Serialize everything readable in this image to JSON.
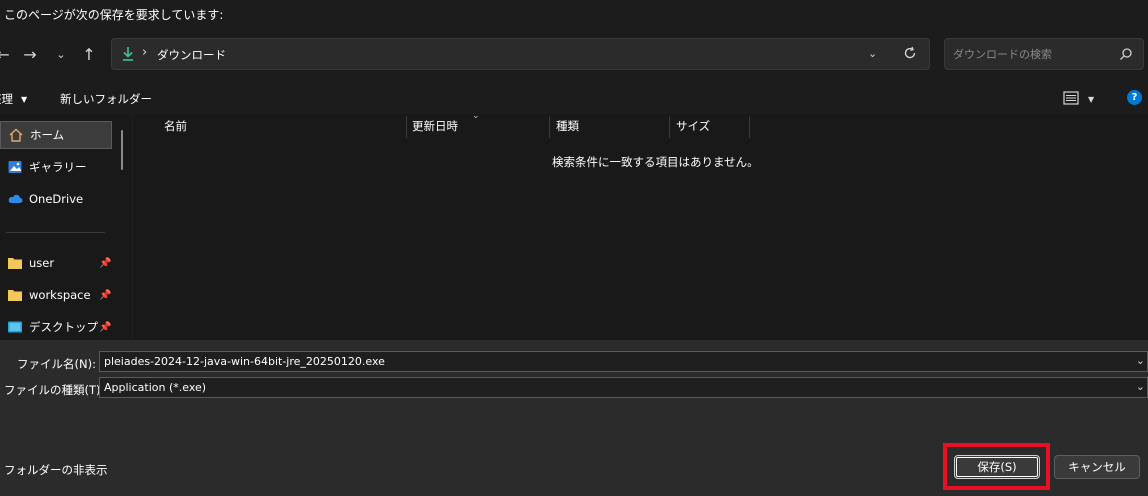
{
  "window": {
    "title": "このページが次の保存を要求しています:"
  },
  "nav": {
    "back_icon": "arrow-left-icon",
    "forward_icon": "arrow-right-icon",
    "recent_icon": "chevron-down-icon",
    "up_icon": "arrow-up-icon",
    "address": {
      "folder_icon": "download-icon",
      "separator": "›",
      "path": "ダウンロード"
    },
    "refresh_icon": "refresh-icon",
    "search": {
      "placeholder": "ダウンロードの検索",
      "icon": "search-icon"
    }
  },
  "toolbar": {
    "organize_label": "整理",
    "new_folder_label": "新しいフォルダー",
    "view_icon": "view-options-icon",
    "help_icon": "help-icon"
  },
  "sidebar": {
    "items": [
      {
        "label": "ホーム",
        "icon": "home-icon",
        "selected": true
      },
      {
        "label": "ギャラリー",
        "icon": "gallery-icon"
      },
      {
        "label": "OneDrive",
        "icon": "cloud-icon"
      },
      {
        "label": "user",
        "icon": "folder-icon",
        "pinned": true
      },
      {
        "label": "workspace",
        "icon": "folder-icon",
        "pinned": true
      },
      {
        "label": "デスクトップ",
        "icon": "desktop-icon",
        "pinned": true
      }
    ]
  },
  "filelist": {
    "columns": [
      "名前",
      "更新日時",
      "種類",
      "サイズ"
    ],
    "empty_message": "検索条件に一致する項目はありません。"
  },
  "form": {
    "filename_label": "ファイル名(N):",
    "filename_value": "pleiades-2024-12-java-win-64bit-jre_20250120.exe",
    "filetype_label": "ファイルの種類(T):",
    "filetype_value": "Application (*.exe)"
  },
  "footer": {
    "hide_folders_label": "フォルダーの非表示",
    "save_label": "保存(S)",
    "cancel_label": "キャンセル"
  },
  "colors": {
    "accent": "#0078d4",
    "highlight_red": "#e81123",
    "download_green": "#3ec28f",
    "folder_yellow": "#f2c75c"
  }
}
